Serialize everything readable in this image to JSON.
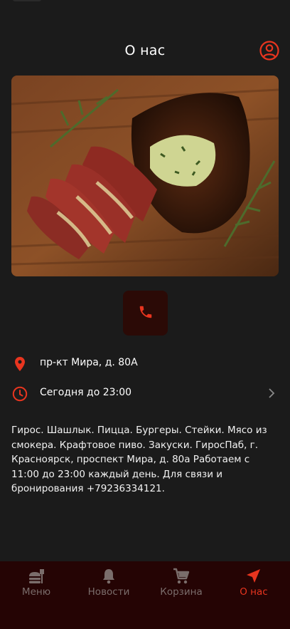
{
  "header": {
    "title": "О нас",
    "profile_icon": "account-circle-icon"
  },
  "hero": {
    "icon": "steak-photo"
  },
  "call": {
    "icon": "phone-icon"
  },
  "address": {
    "icon": "map-pin-icon",
    "text": "пр-кт Мира, д. 80А"
  },
  "hours": {
    "icon": "clock-icon",
    "text": "Сегодня до 23:00",
    "chevron": "chevron-right-icon"
  },
  "description": "Гирос. Шашлык. Пицца. Бургеры. Стейки. Мясо из смокера. Крафтовое пиво. Закуски. ГиросПаб, г. Красноярск, проспект Мира, д. 80а Работаем с 11:00 до 23:00 каждый день. Для связи и бронирования +79236334121.",
  "tabs": [
    {
      "label": "Меню",
      "icon": "menu-food-icon",
      "active": false
    },
    {
      "label": "Новости",
      "icon": "bell-icon",
      "active": false
    },
    {
      "label": "Корзина",
      "icon": "cart-icon",
      "active": false
    },
    {
      "label": "О нас",
      "icon": "navigation-arrow-icon",
      "active": true
    }
  ],
  "colors": {
    "accent": "#e8351f",
    "background": "#1b1b1b",
    "tabbar": "#250404",
    "call_button": "#2b0a06",
    "inactive": "#7a6d6b"
  }
}
